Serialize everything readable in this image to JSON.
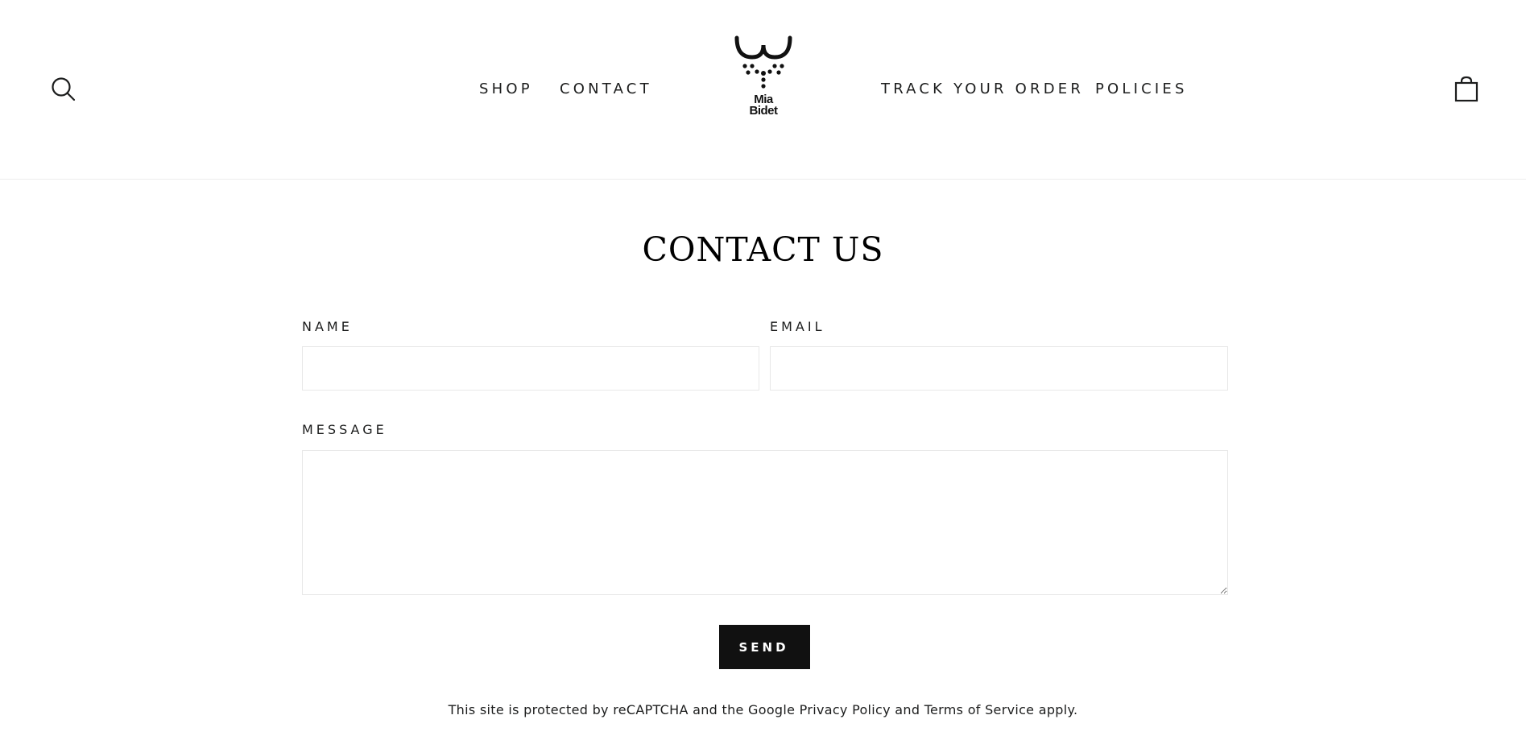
{
  "header": {
    "search_icon": "search-icon",
    "cart_icon": "cart-icon",
    "nav_left": [
      {
        "label": "SHOP"
      },
      {
        "label": "CONTACT"
      }
    ],
    "nav_right": [
      {
        "label": "TRACK YOUR ORDER"
      },
      {
        "label": "POLICIES"
      }
    ],
    "logo": {
      "line1": "Mia",
      "line2": "Bidet"
    }
  },
  "main": {
    "title": "CONTACT US",
    "form": {
      "name_label": "NAME",
      "name_value": "",
      "email_label": "EMAIL",
      "email_value": "",
      "message_label": "MESSAGE",
      "message_value": "",
      "send_label": "SEND"
    },
    "recaptcha": {
      "prefix": "This site is protected by reCAPTCHA and the Google ",
      "privacy_link": "Privacy Policy",
      "middle": " and ",
      "terms_link": "Terms of Service",
      "suffix": " apply."
    }
  },
  "colors": {
    "text": "#1c1d1d",
    "button_bg": "#111111",
    "button_text": "#ffffff",
    "input_border": "#e8e8e8",
    "background": "#ffffff"
  }
}
